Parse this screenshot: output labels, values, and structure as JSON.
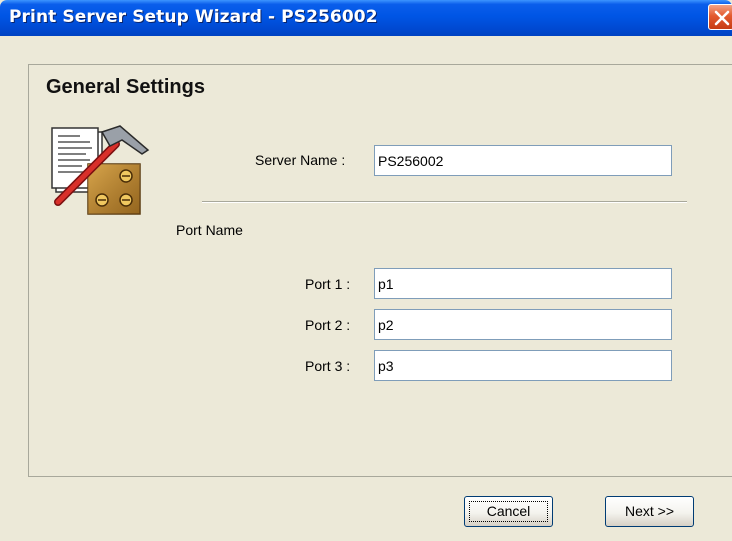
{
  "window": {
    "title": "Print Server Setup Wizard - PS256002",
    "close_icon": "close-icon"
  },
  "page": {
    "heading": "General Settings",
    "icon": "wizard-tools-icon"
  },
  "server": {
    "label": "Server Name :",
    "value": "PS256002"
  },
  "ports": {
    "section_label": "Port Name",
    "items": [
      {
        "label": "Port 1 :",
        "value": "p1"
      },
      {
        "label": "Port 2 :",
        "value": "p2"
      },
      {
        "label": "Port 3 :",
        "value": "p3"
      }
    ]
  },
  "buttons": {
    "cancel": "Cancel",
    "next": "Next >>"
  },
  "colors": {
    "titlebar": "#0055E5",
    "close": "#E35A2E",
    "face": "#ECE9D8",
    "field_border": "#7F9DB9"
  }
}
